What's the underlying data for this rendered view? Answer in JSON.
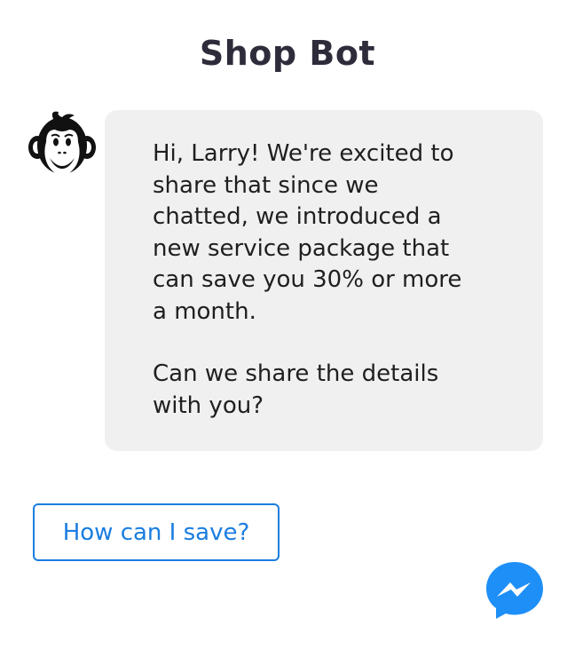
{
  "header": {
    "title": "Shop Bot"
  },
  "bot": {
    "avatar_icon": "monkey-logo-icon"
  },
  "message": {
    "paragraph_1": "Hi, Larry! We're excited to\nshare that since we\nchatted, we introduced a\nnew service package that\ncan save you 30% or more\na month.",
    "paragraph_2": "Can we share the details\nwith you?"
  },
  "quick_reply": {
    "label": "How can I save?"
  },
  "messenger": {
    "icon": "messenger-icon"
  },
  "colors": {
    "accent": "#1a7de0",
    "bubble_background": "#f0f0f0",
    "title_color": "#2e2c3b",
    "messenger_blue": "#1e8ff7"
  }
}
